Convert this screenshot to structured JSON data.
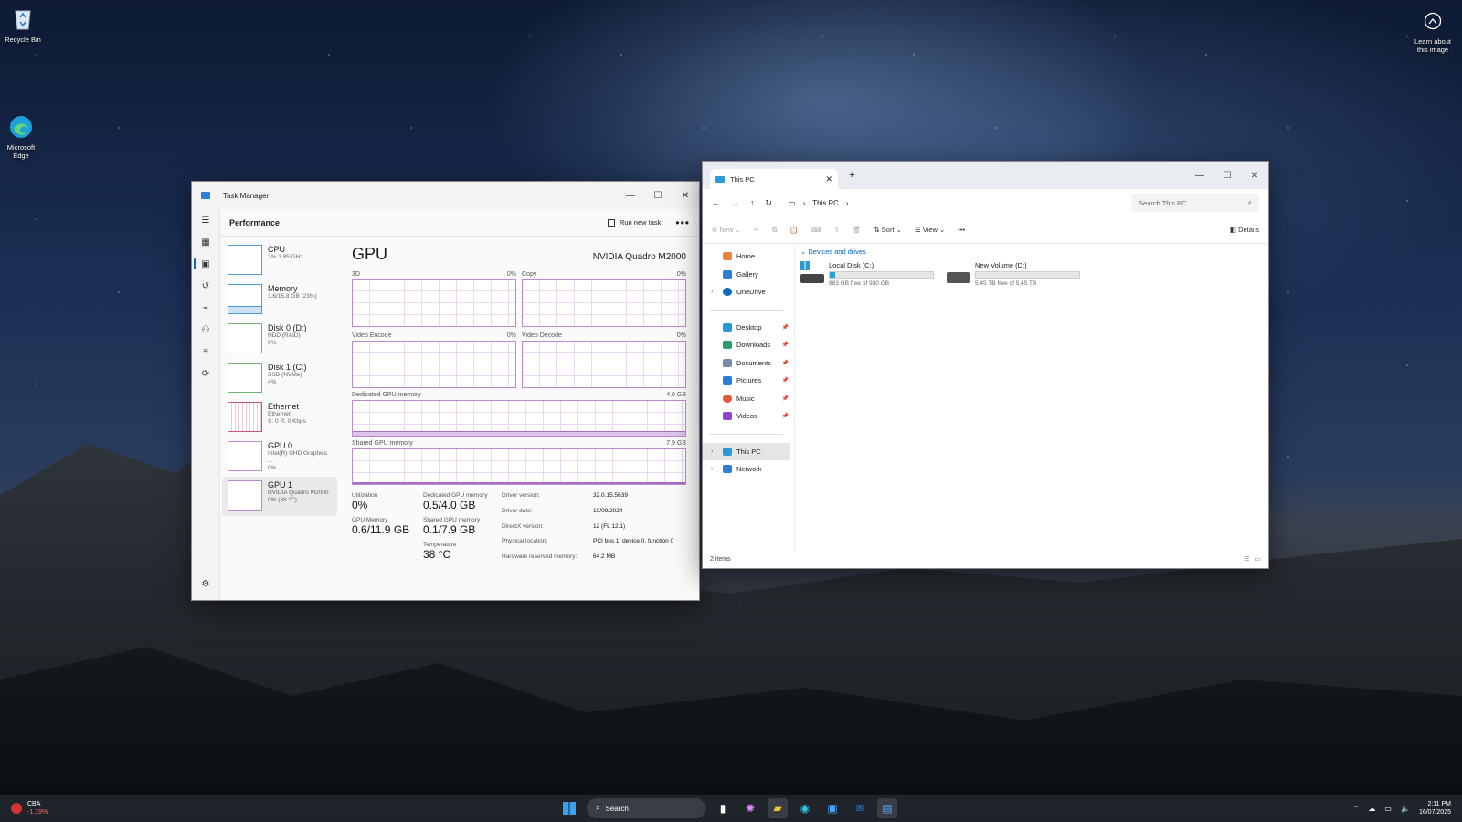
{
  "desktop": {
    "icons": [
      {
        "label": "Recycle Bin",
        "icon": "recycle-bin-icon"
      },
      {
        "label": "Microsoft Edge",
        "icon": "edge-icon"
      }
    ],
    "learn_about": "Learn about this image"
  },
  "task_manager": {
    "title": "Task Manager",
    "page_title": "Performance",
    "run_new_task": "Run new task",
    "more": "•••",
    "resources": [
      {
        "name": "CPU",
        "sub1": "2% 3.85 GHz",
        "sub2": "",
        "sub3": ""
      },
      {
        "name": "Memory",
        "sub1": "3.6/15.8 GB (23%)",
        "sub2": "",
        "sub3": ""
      },
      {
        "name": "Disk 0 (D:)",
        "sub1": "HDD (RAID)",
        "sub2": "0%",
        "sub3": ""
      },
      {
        "name": "Disk 1 (C:)",
        "sub1": "SSD (NVMe)",
        "sub2": "4%",
        "sub3": ""
      },
      {
        "name": "Ethernet",
        "sub1": "Ethernet",
        "sub2": "S: 0 R: 0 Kbps",
        "sub3": ""
      },
      {
        "name": "GPU 0",
        "sub1": "Intel(R) UHD Graphics ...",
        "sub2": "0%",
        "sub3": ""
      },
      {
        "name": "GPU 1",
        "sub1": "NVIDIA Quadro M2000",
        "sub2": "0% (38 °C)",
        "sub3": ""
      }
    ],
    "gpu": {
      "heading": "GPU",
      "model": "NVIDIA Quadro M2000",
      "graphs": [
        {
          "label": "3D",
          "pct": "0%"
        },
        {
          "label": "Copy",
          "pct": "0%"
        },
        {
          "label": "Video Encode",
          "pct": "0%"
        },
        {
          "label": "Video Decode",
          "pct": "0%"
        }
      ],
      "dedicated_label": "Dedicated GPU memory",
      "dedicated_max": "4.0 GB",
      "shared_label": "Shared GPU memory",
      "shared_max": "7.9 GB",
      "stats": {
        "utilization_label": "Utilization",
        "utilization": "0%",
        "dedicated_mem_label": "Dedicated GPU memory",
        "dedicated_mem": "0.5/4.0 GB",
        "gpu_mem_label": "GPU Memory",
        "gpu_mem": "0.6/11.9 GB",
        "shared_mem_label": "Shared GPU memory",
        "shared_mem": "0.1/7.9 GB",
        "temp_label": "Temperature",
        "temp": "38 °C"
      },
      "details": [
        {
          "k": "Driver version:",
          "v": "32.0.15.5639"
        },
        {
          "k": "Driver date:",
          "v": "10/09/2024"
        },
        {
          "k": "DirectX version:",
          "v": "12 (FL 12.1)"
        },
        {
          "k": "Physical location:",
          "v": "PCI bus 1, device 0, function 0"
        },
        {
          "k": "Hardware reserved memory:",
          "v": "64.2 MB"
        }
      ]
    }
  },
  "explorer": {
    "tab_title": "This PC",
    "breadcrumb": "This PC",
    "search_placeholder": "Search This PC",
    "toolbar": {
      "new": "New",
      "sort": "Sort",
      "view": "View",
      "more": "•••",
      "details": "Details"
    },
    "nav": [
      {
        "label": "Home",
        "color": "#e8833a"
      },
      {
        "label": "Gallery",
        "color": "#2b7fd4"
      },
      {
        "label": "OneDrive",
        "color": "#0f6cbd"
      },
      {
        "label": "Desktop",
        "color": "#2b9ad4"
      },
      {
        "label": "Downloads",
        "color": "#2a9d6f"
      },
      {
        "label": "Documents",
        "color": "#7a8aa3"
      },
      {
        "label": "Pictures",
        "color": "#2b7fd4"
      },
      {
        "label": "Music",
        "color": "#e05a3a"
      },
      {
        "label": "Videos",
        "color": "#8a44c8"
      },
      {
        "label": "This PC",
        "color": "#2b9ad4"
      },
      {
        "label": "Network",
        "color": "#2b7fd4"
      }
    ],
    "section": "Devices and drives",
    "drives": [
      {
        "name": "Local Disk (C:)",
        "free": "883 GB free of 930 GB",
        "used_fraction": 0.05
      },
      {
        "name": "New Volume (D:)",
        "free": "5.45 TB free of 5.45 TB",
        "used_fraction": 0.0
      }
    ],
    "status": "2 items"
  },
  "taskbar": {
    "stock_name": "CBA",
    "stock_change": "-1.19%",
    "search": "Search",
    "time": "2:11 PM",
    "date": "16/07/2025"
  }
}
